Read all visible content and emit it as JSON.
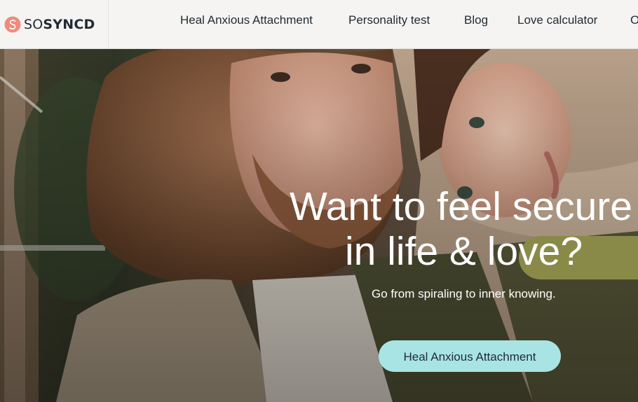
{
  "header": {
    "logo": {
      "name": "sosyncd-logo-icon",
      "text_prefix": "SO",
      "text_suffix": "SYNCD",
      "color": "#ef8b7b"
    },
    "nav": [
      {
        "label": "Heal Anxious Attachment"
      },
      {
        "label": "Personality test"
      },
      {
        "label": "Blog"
      },
      {
        "label": "Love calculator"
      },
      {
        "label": "O"
      }
    ]
  },
  "hero": {
    "headline_line1_a": "Want to feel ",
    "headline_highlight": "secure",
    "headline_line2": "in life & love?",
    "subtitle": "Go from spiraling to inner knowing.",
    "cta_label": "Heal Anxious Attachment",
    "highlight_color": "#8a8a48",
    "cta_color": "#a9e4e4"
  }
}
